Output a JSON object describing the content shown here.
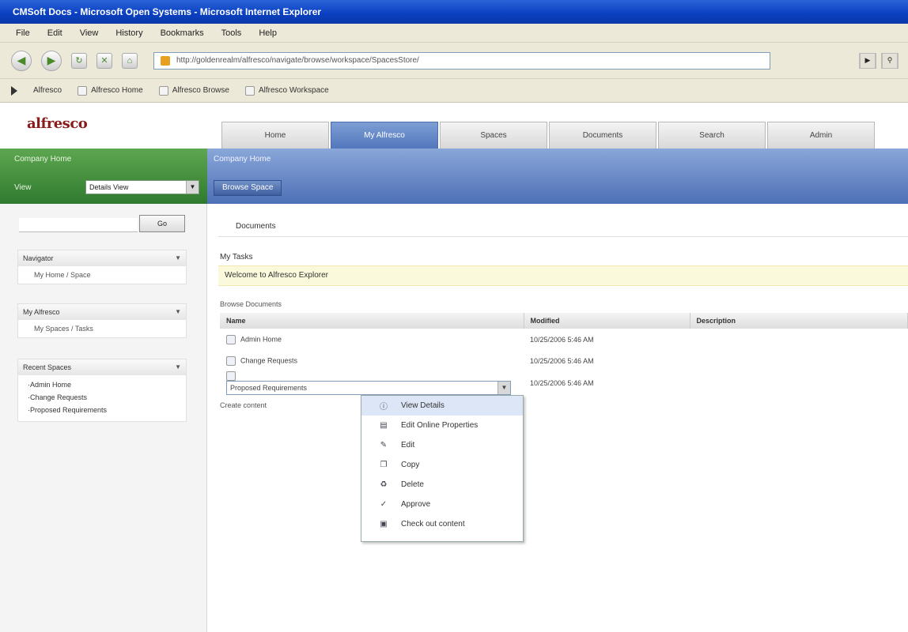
{
  "window": {
    "title": "CMSoft Docs - Microsoft Open Systems - Microsoft Internet Explorer"
  },
  "menu": [
    "File",
    "Edit",
    "View",
    "History",
    "Bookmarks",
    "Tools",
    "Help"
  ],
  "address": {
    "url": "http://goldenrealm/alfresco/navigate/browse/workspace/SpacesStore/"
  },
  "bookmarks": [
    "Alfresco",
    "Alfresco Home",
    "Alfresco Browse",
    "Alfresco Workspace"
  ],
  "app": {
    "logo": "alfresco",
    "tabs": [
      "Home",
      "My Alfresco",
      "Spaces",
      "Documents",
      "Search",
      "Admin"
    ],
    "active_tab": 1
  },
  "green_panel": {
    "title": "Company Home",
    "label": "View",
    "select_value": "Details View"
  },
  "blue_panel": {
    "title": "Company Home",
    "button": "Browse Space"
  },
  "sidebar": {
    "go_button": "Go",
    "panels": [
      {
        "title": "Navigator",
        "body": "My Home / Space"
      },
      {
        "title": "My Alfresco",
        "body": "My Spaces / Tasks"
      },
      {
        "title": "Recent Spaces",
        "items": [
          "Admin Home",
          "Change Requests",
          "Proposed Requirements"
        ]
      }
    ]
  },
  "main": {
    "breadcrumb": "Documents",
    "section_label": "My Tasks",
    "notice": "Welcome to Alfresco Explorer",
    "table_label": "Browse Documents",
    "columns": [
      "Name",
      "Modified",
      "Description"
    ],
    "rows": [
      {
        "name": "Admin Home",
        "modified": "10/25/2006 5:46 AM"
      },
      {
        "name": "Change Requests",
        "modified": "10/25/2006 5:46 AM"
      },
      {
        "name": "Proposed Requirements",
        "modified": "10/25/2006 5:46 AM",
        "select": true
      }
    ],
    "create_line": "Create content"
  },
  "dropdown": {
    "items": [
      {
        "icon": "info-icon",
        "label": "View Details"
      },
      {
        "icon": "document-icon",
        "label": "Edit Online Properties"
      },
      {
        "icon": "pencil-icon",
        "label": "Edit"
      },
      {
        "icon": "copy-icon",
        "label": "Copy"
      },
      {
        "icon": "trash-icon",
        "label": "Delete"
      },
      {
        "icon": "check-icon",
        "label": "Approve"
      },
      {
        "icon": "checkout-icon",
        "label": "Check out content"
      }
    ],
    "selected_index": 0
  }
}
